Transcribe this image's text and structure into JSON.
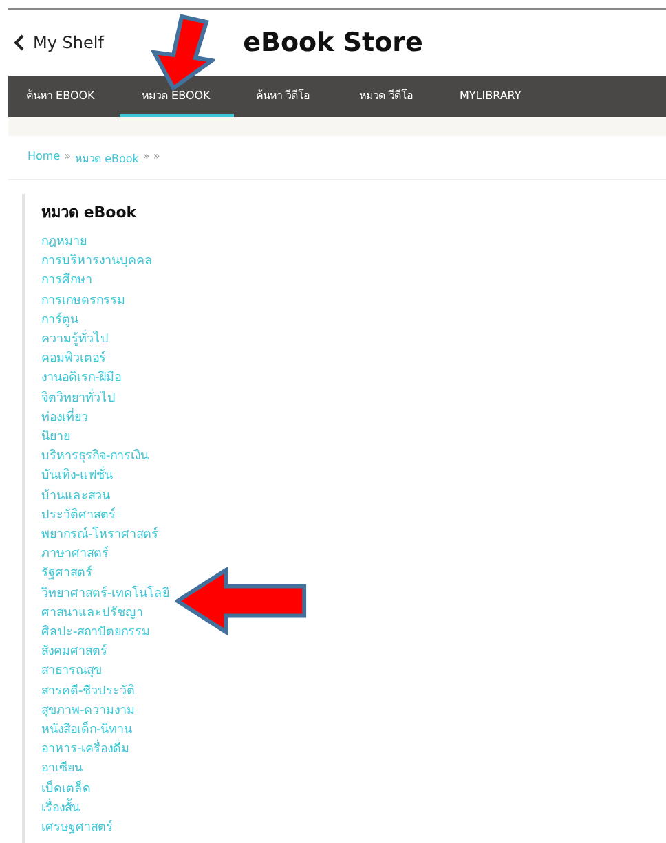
{
  "header": {
    "back_label": "My Shelf",
    "title": "eBook Store"
  },
  "tabs": [
    {
      "label": "ค้นหา EBOOK",
      "selected": false
    },
    {
      "label": "หมวด EBOOK",
      "selected": true
    },
    {
      "label": "ค้นหา วีดีโอ",
      "selected": false
    },
    {
      "label": "หมวด วีดีโอ",
      "selected": false
    },
    {
      "label": "MYLIBRARY",
      "selected": false
    }
  ],
  "breadcrumb": [
    {
      "text": "Home",
      "kind": "link"
    },
    {
      "text": "»",
      "kind": "sep"
    },
    {
      "text": "หมวด eBook",
      "kind": "link"
    },
    {
      "text": "» »",
      "kind": "sep"
    }
  ],
  "category_panel": {
    "heading": "หมวด eBook",
    "items": [
      "กฎหมาย",
      "การบริหารงานบุคคล",
      "การศึกษา",
      "การเกษตรกรรม",
      "การ์ตูน",
      "ความรู้ทั่วไป",
      "คอมพิวเตอร์",
      "งานอดิเรก-ฝีมือ",
      "จิตวิทยาทั่วไป",
      "ท่องเที่ยว",
      "นิยาย",
      "บริหารธุรกิจ-การเงิน",
      "บันเทิง-แฟชั่น",
      "บ้านและสวน",
      "ประวัติศาสตร์",
      "พยากรณ์-โหราศาสตร์",
      "ภาษาศาสตร์",
      "รัฐศาสตร์",
      "วิทยาศาสตร์-เทคโนโลยี",
      "ศาสนาและปรัชญา",
      "ศิลปะ-สถาปัตยกรรม",
      "สังคมศาสตร์",
      "สาธารณสุข",
      "สารคดี-ชีวประวัติ",
      "สุขภาพ-ความงาม",
      "หนังสือเด็ก-นิทาน",
      "อาหาร-เครื่องดื่ม",
      "อาเซียน",
      "เบ็ดเตล็ด",
      "เรื่องสั้น",
      "เศรษฐศาสตร์"
    ]
  },
  "annotations": [
    {
      "kind": "arrow-down"
    },
    {
      "kind": "arrow-left"
    }
  ]
}
